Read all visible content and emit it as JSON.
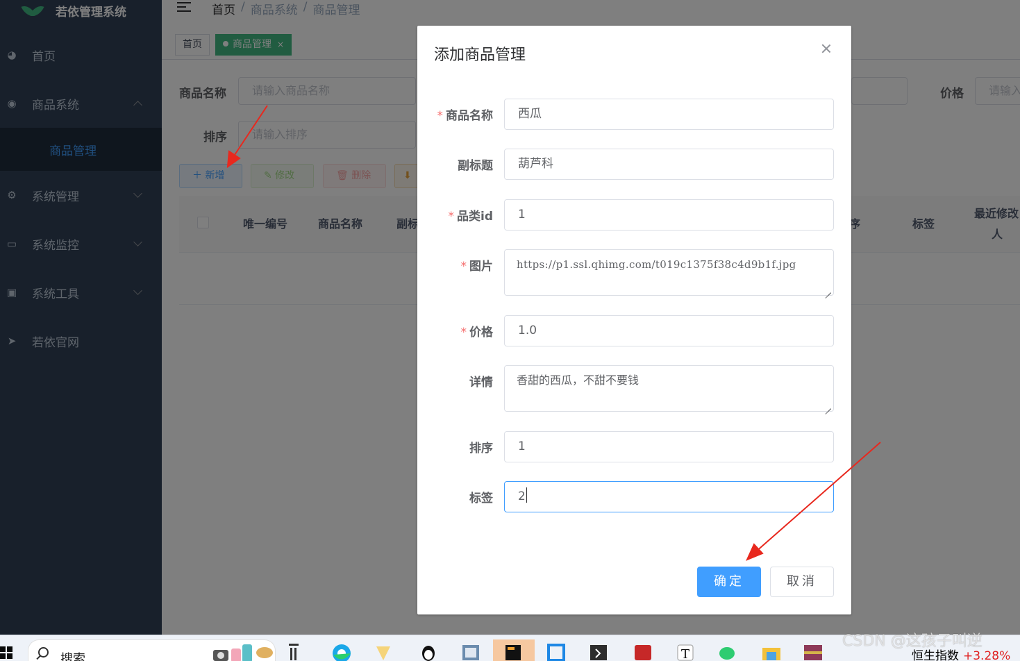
{
  "app": {
    "logo_title": "若依管理系统"
  },
  "sidebar": {
    "items": [
      {
        "label": "首页",
        "icon": "dashboard-icon"
      },
      {
        "label": "商品系统",
        "icon": "circle-dot-icon",
        "expanded": true
      },
      {
        "label": "系统管理",
        "icon": "gear-icon"
      },
      {
        "label": "系统监控",
        "icon": "monitor-icon"
      },
      {
        "label": "系统工具",
        "icon": "toolbox-icon"
      },
      {
        "label": "若依官网",
        "icon": "send-icon"
      }
    ],
    "submenu_active": "商品管理"
  },
  "header": {
    "breadcrumb": [
      "首页",
      "/",
      "商品系统",
      "/",
      "商品管理"
    ]
  },
  "tags": {
    "home": "首页",
    "active": "商品管理",
    "close": "×"
  },
  "search": {
    "name_label": "商品名称",
    "name_placeholder": "请输入商品名称",
    "sort_label": "排序",
    "sort_placeholder": "请输入排序",
    "price_label": "价格",
    "price_placeholder": "请输入"
  },
  "toolbar": {
    "add": "＋ 新增",
    "edit": "✎ 修改",
    "delete": "🗑 删除",
    "export": "⬇"
  },
  "table": {
    "headers": [
      "唯一编号",
      "商品名称",
      "副标",
      "序",
      "标签",
      "最近修改",
      "人"
    ]
  },
  "dialog": {
    "title": "添加商品管理",
    "fields": {
      "name": {
        "label": "商品名称",
        "required": true,
        "value": "西瓜"
      },
      "subtitle": {
        "label": "副标题",
        "required": false,
        "value": "葫芦科"
      },
      "category": {
        "label": "品类id",
        "required": true,
        "value": "1"
      },
      "image": {
        "label": "图片",
        "required": true,
        "value": "https://p1.ssl.qhimg.com/t019c1375f38c4d9b1f.jpg"
      },
      "price": {
        "label": "价格",
        "required": true,
        "value": "1.0"
      },
      "detail": {
        "label": "详情",
        "required": false,
        "value": "香甜的西瓜，不甜不要钱"
      },
      "sort": {
        "label": "排序",
        "required": false,
        "value": "1"
      },
      "tag": {
        "label": "标签",
        "required": false,
        "value": "2"
      }
    },
    "required_mark": "*",
    "confirm": "确定",
    "cancel": "取消"
  },
  "taskbar": {
    "search_text": "搜索",
    "ticker_name": "恒生指数",
    "ticker_change": "+3.28%"
  },
  "watermark": "CSDN @这孩子叫逆",
  "colors": {
    "sidebar_bg": "#304156",
    "primary": "#409eff",
    "success": "#42b983",
    "danger": "#f56c6c",
    "annotation": "#e8281e"
  }
}
